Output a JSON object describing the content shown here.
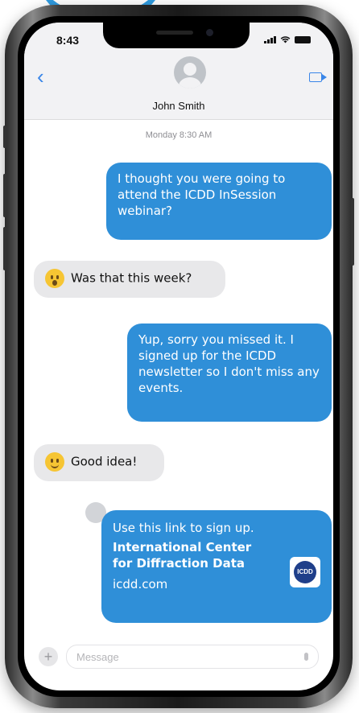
{
  "status": {
    "time": "8:43"
  },
  "contact": {
    "name": "John Smith"
  },
  "thread": {
    "timestamp": "Monday 8:30 AM"
  },
  "messages": [
    {
      "direction": "outgoing",
      "text": "I thought you were going to attend the ICDD InSession webinar?"
    },
    {
      "direction": "incoming",
      "emoji": "surprised-face",
      "text": "Was that this week?"
    },
    {
      "direction": "outgoing",
      "text": "Yup, sorry you missed it. I signed up for the ICDD newsletter so I don't miss any events."
    },
    {
      "direction": "incoming",
      "emoji": "smiling-face",
      "text": "Good idea!"
    }
  ],
  "link_preview": {
    "intro": "Use this link to sign up.",
    "title": "International Center for Diffraction Data",
    "url": "icdd.com",
    "logo_text": "ICDD"
  },
  "composer": {
    "placeholder": "Message"
  },
  "colors": {
    "outgoing_bubble": "#2f8fd8",
    "incoming_bubble": "#e8e8ea",
    "accent": "#3a86e8"
  }
}
